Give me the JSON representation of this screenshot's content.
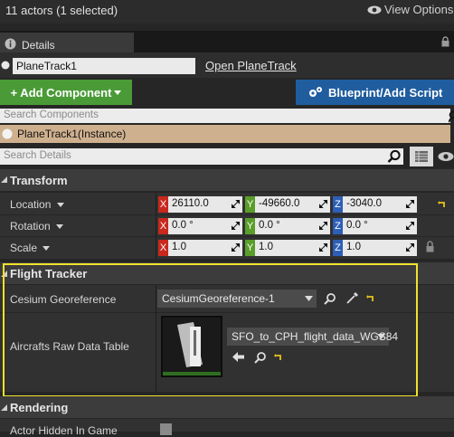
{
  "header": {
    "actors_count": "11 actors (1 selected)",
    "view_options": "View Options"
  },
  "tab": {
    "label": "Details"
  },
  "actor": {
    "name": "PlaneTrack1",
    "open_link": "Open PlaneTrack"
  },
  "buttons": {
    "add_component": "+ Add Component",
    "blueprint": "Blueprint/Add Script"
  },
  "search": {
    "components_placeholder": "Search Components",
    "details_placeholder": "Search Details"
  },
  "component": {
    "instance_label": "PlaneTrack1(Instance)"
  },
  "transform": {
    "title": "Transform",
    "location": {
      "label": "Location",
      "x": "26110.0",
      "y": "-49660.0",
      "z": "-3040.0"
    },
    "rotation": {
      "label": "Rotation",
      "x": "0.0 °",
      "y": "0.0 °",
      "z": "0.0 °"
    },
    "scale": {
      "label": "Scale",
      "x": "1.0",
      "y": "1.0",
      "z": "1.0"
    }
  },
  "axes": {
    "x": "X",
    "y": "Y",
    "z": "Z"
  },
  "flight_tracker": {
    "title": "Flight Tracker",
    "georeference_label": "Cesium Georeference",
    "georeference_value": "CesiumGeoreference-1",
    "data_table_label": "Aircrafts Raw Data Table",
    "data_table_value": "SFO_to_CPH_flight_data_WGS84"
  },
  "rendering": {
    "title": "Rendering",
    "actor_hidden_label": "Actor Hidden In Game"
  },
  "colors": {
    "highlight": "#f2e22a",
    "add_button": "#4a9b37",
    "blueprint_button": "#1f5d9f",
    "selected_component": "#cfb08e"
  }
}
